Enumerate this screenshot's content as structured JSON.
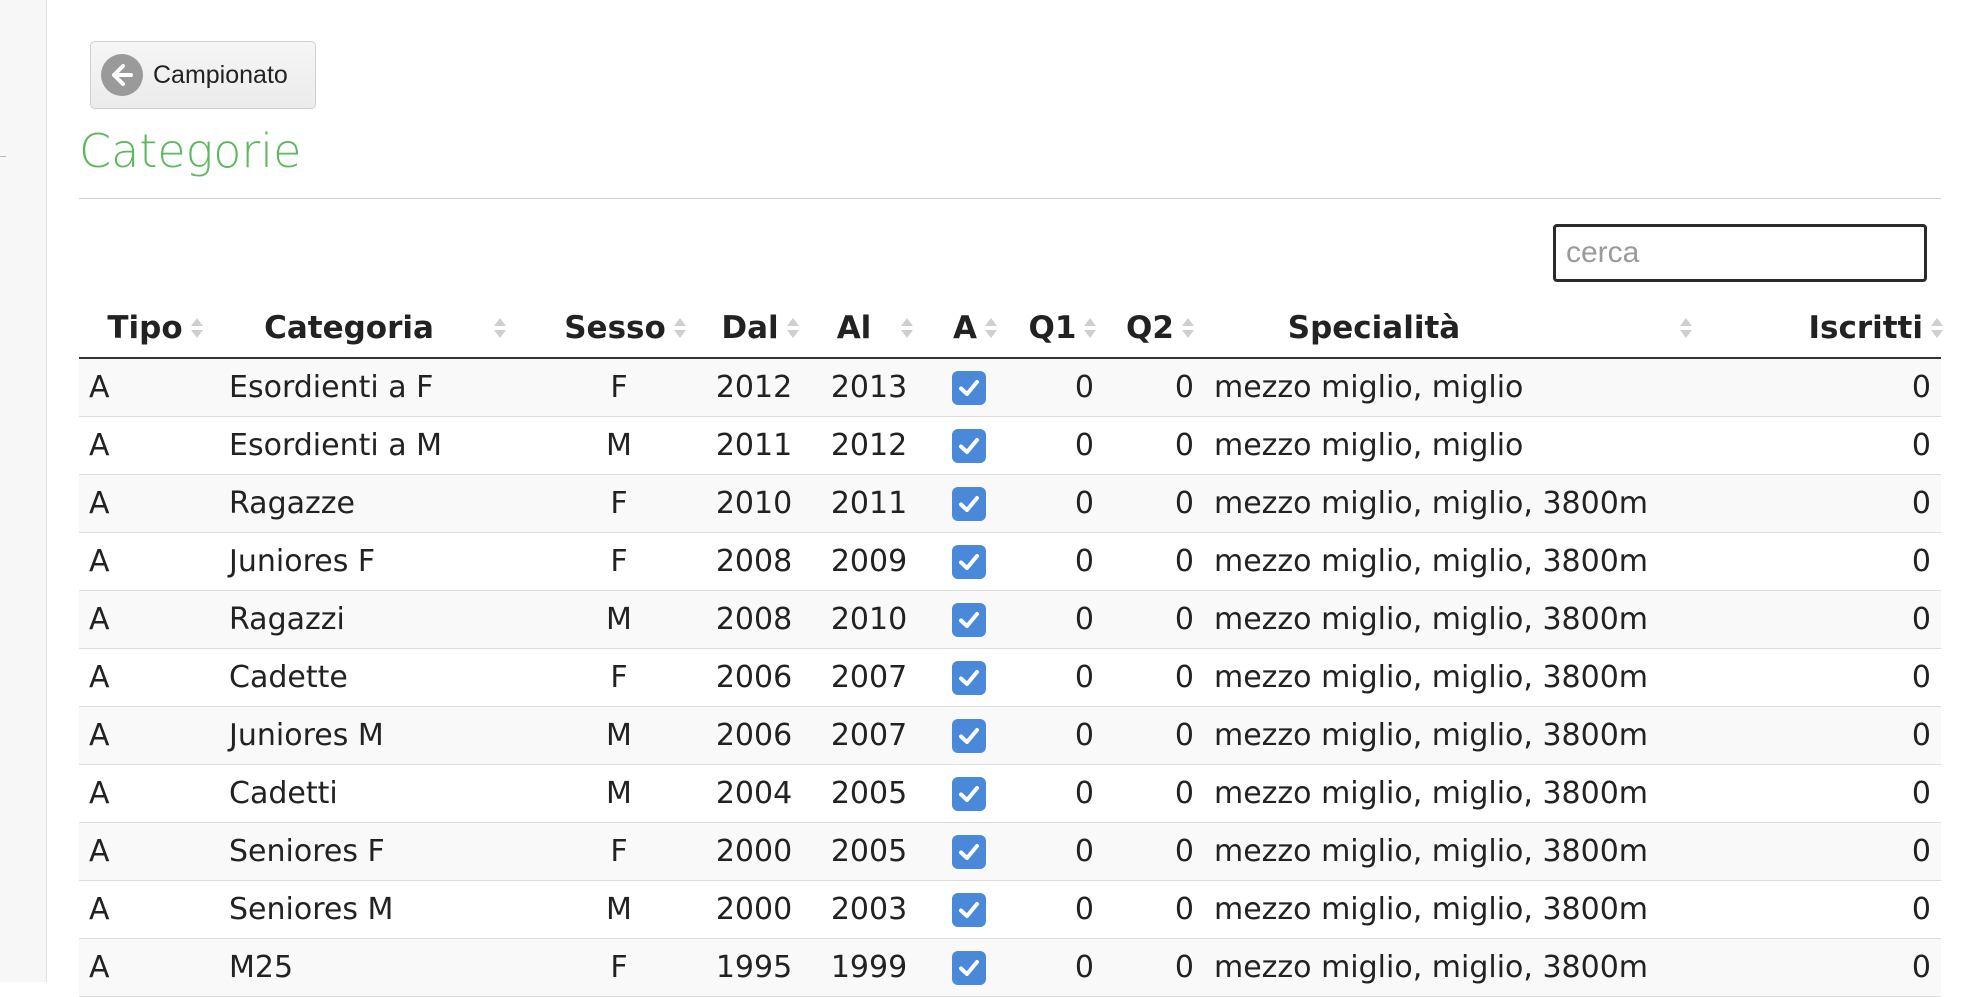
{
  "back_button": {
    "label": "Campionato",
    "icon": "arrow-left-circle-icon"
  },
  "page_title": "Categorie",
  "search": {
    "placeholder": "cerca",
    "value": ""
  },
  "table": {
    "headers": {
      "tipo": "Tipo",
      "categoria": "Categoria",
      "sesso": "Sesso",
      "dal": "Dal",
      "al": "Al",
      "a": "A",
      "q1": "Q1",
      "q2": "Q2",
      "specialita": "Specialità",
      "iscritti": "Iscritti"
    },
    "rows": [
      {
        "tipo": "A",
        "categoria": "Esordienti a F",
        "sesso": "F",
        "dal": "2012",
        "al": "2013",
        "a": true,
        "q1": "0",
        "q2": "0",
        "specialita": "mezzo miglio, miglio",
        "iscritti": "0"
      },
      {
        "tipo": "A",
        "categoria": "Esordienti a M",
        "sesso": "M",
        "dal": "2011",
        "al": "2012",
        "a": true,
        "q1": "0",
        "q2": "0",
        "specialita": "mezzo miglio, miglio",
        "iscritti": "0"
      },
      {
        "tipo": "A",
        "categoria": "Ragazze",
        "sesso": "F",
        "dal": "2010",
        "al": "2011",
        "a": true,
        "q1": "0",
        "q2": "0",
        "specialita": "mezzo miglio, miglio, 3800m",
        "iscritti": "0"
      },
      {
        "tipo": "A",
        "categoria": "Juniores F",
        "sesso": "F",
        "dal": "2008",
        "al": "2009",
        "a": true,
        "q1": "0",
        "q2": "0",
        "specialita": "mezzo miglio, miglio, 3800m",
        "iscritti": "0"
      },
      {
        "tipo": "A",
        "categoria": "Ragazzi",
        "sesso": "M",
        "dal": "2008",
        "al": "2010",
        "a": true,
        "q1": "0",
        "q2": "0",
        "specialita": "mezzo miglio, miglio, 3800m",
        "iscritti": "0"
      },
      {
        "tipo": "A",
        "categoria": "Cadette",
        "sesso": "F",
        "dal": "2006",
        "al": "2007",
        "a": true,
        "q1": "0",
        "q2": "0",
        "specialita": "mezzo miglio, miglio, 3800m",
        "iscritti": "0"
      },
      {
        "tipo": "A",
        "categoria": "Juniores M",
        "sesso": "M",
        "dal": "2006",
        "al": "2007",
        "a": true,
        "q1": "0",
        "q2": "0",
        "specialita": "mezzo miglio, miglio, 3800m",
        "iscritti": "0"
      },
      {
        "tipo": "A",
        "categoria": "Cadetti",
        "sesso": "M",
        "dal": "2004",
        "al": "2005",
        "a": true,
        "q1": "0",
        "q2": "0",
        "specialita": "mezzo miglio, miglio, 3800m",
        "iscritti": "0"
      },
      {
        "tipo": "A",
        "categoria": "Seniores F",
        "sesso": "F",
        "dal": "2000",
        "al": "2005",
        "a": true,
        "q1": "0",
        "q2": "0",
        "specialita": "mezzo miglio, miglio, 3800m",
        "iscritti": "0"
      },
      {
        "tipo": "A",
        "categoria": "Seniores M",
        "sesso": "M",
        "dal": "2000",
        "al": "2003",
        "a": true,
        "q1": "0",
        "q2": "0",
        "specialita": "mezzo miglio, miglio, 3800m",
        "iscritti": "0"
      },
      {
        "tipo": "A",
        "categoria": "M25",
        "sesso": "F",
        "dal": "1995",
        "al": "1999",
        "a": true,
        "q1": "0",
        "q2": "0",
        "specialita": "mezzo miglio, miglio, 3800m",
        "iscritti": "0"
      }
    ]
  },
  "colors": {
    "title": "#5cb85c",
    "checkbox": "#4a89d9",
    "row_stripe": "#f9f9f9"
  }
}
